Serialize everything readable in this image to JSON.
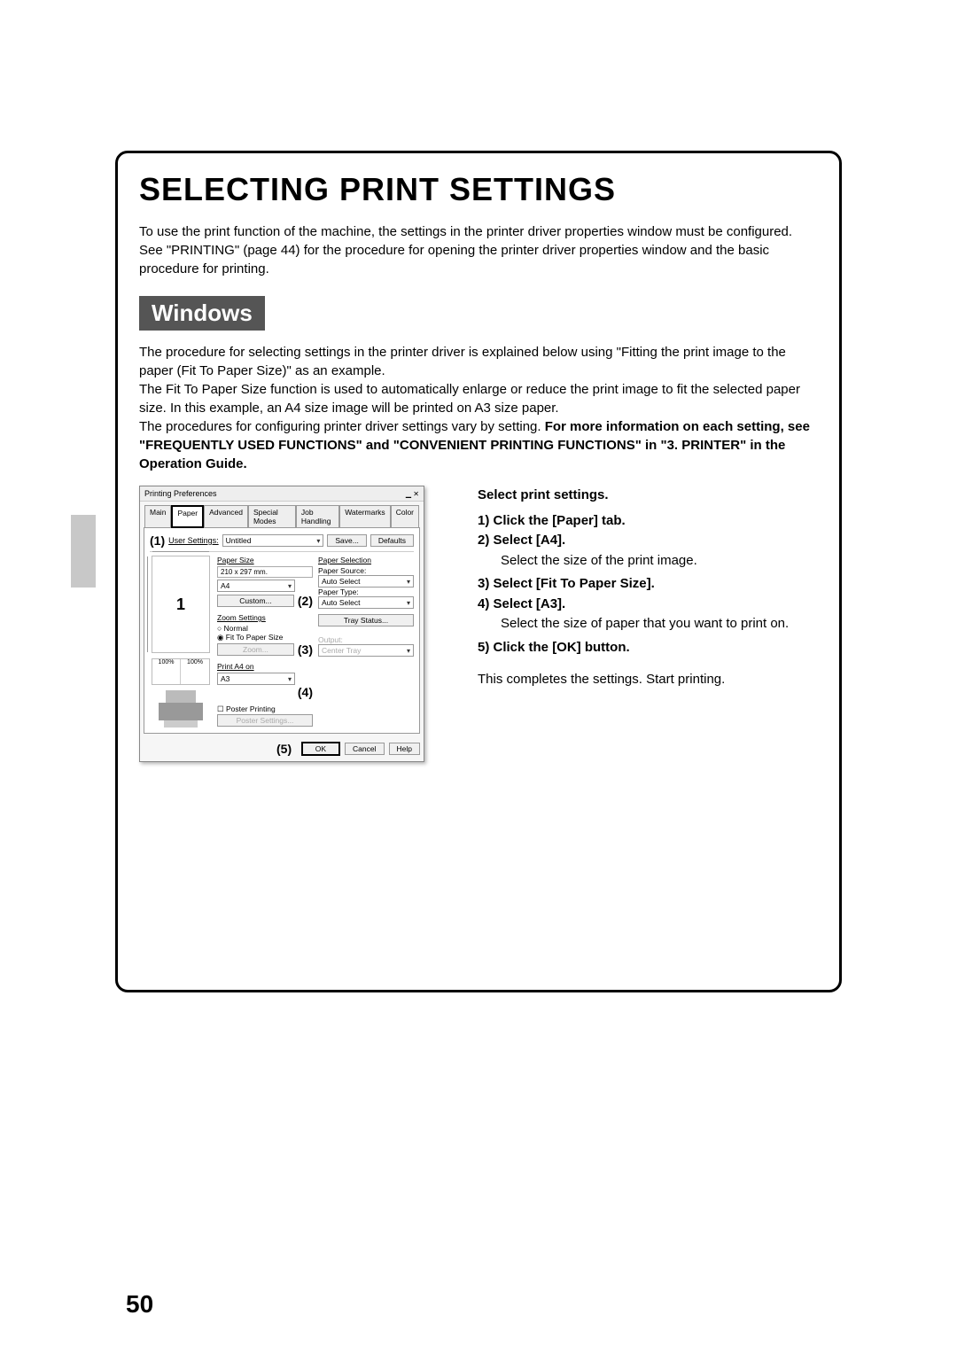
{
  "page_number": "50",
  "title": "SELECTING PRINT SETTINGS",
  "intro": "To use the print function of the machine, the settings in the printer driver properties window must be configured. See \"PRINTING\" (page 44) for the procedure for opening the printer driver properties window and the basic procedure for printing.",
  "os_label": "Windows",
  "para1": "The procedure for selecting settings in the printer driver is explained below using \"Fitting the print image to the paper (Fit To Paper Size)\" as an example.",
  "para2": "The Fit To Paper Size function is used to automatically enlarge or reduce the print image to fit the selected paper size. In this example, an A4 size image will be printed on A3 size paper.",
  "para3a": "The procedures for configuring printer driver settings vary by setting. ",
  "para3b": "For more information on each setting, see \"FREQUENTLY USED FUNCTIONS\" and \"CONVENIENT PRINTING FUNCTIONS\" in \"3. PRINTER\" in the Operation Guide.",
  "right": {
    "heading": "Select print settings.",
    "s1": "1)  Click the [Paper] tab.",
    "s2": "2)  Select [A4].",
    "s2d": "Select the size of the print image.",
    "s3": "3)  Select [Fit To Paper Size].",
    "s4": "4)  Select [A3].",
    "s4d": "Select the size of paper that you want to print on.",
    "s5": "5)  Click the [OK] button.",
    "done": "This completes the settings. Start printing."
  },
  "win": {
    "title": "Printing Preferences",
    "tabs": [
      "Main",
      "Paper",
      "Advanced",
      "Special Modes",
      "Job Handling",
      "Watermarks",
      "Color"
    ],
    "user_settings_label": "User Settings:",
    "user_settings_value": "Untitled",
    "save": "Save...",
    "defaults": "Defaults",
    "paper_size_label": "Paper Size",
    "paper_size_dim": "210 x 297 mm.",
    "paper_size_value": "A4",
    "custom": "Custom...",
    "zoom_label": "Zoom Settings",
    "zoom_normal": "Normal",
    "zoom_fit": "Fit To Paper Size",
    "zoom_btn": "Zoom...",
    "print_on_label": "Print A4 on",
    "print_on_value": "A3",
    "poster_chk": "Poster Printing",
    "poster_btn": "Poster Settings...",
    "sel_label": "Paper Selection",
    "source_label": "Paper Source:",
    "source_value": "Auto Select",
    "type_label": "Paper Type:",
    "type_value": "Auto Select",
    "tray_status": "Tray Status...",
    "output_label": "Output:",
    "output_value": "Center Tray",
    "ok": "OK",
    "cancel": "Cancel",
    "help": "Help"
  },
  "callouts": {
    "c1": "(1)",
    "c2": "(2)",
    "c3": "(3)",
    "c4": "(4)",
    "c5": "(5)"
  }
}
